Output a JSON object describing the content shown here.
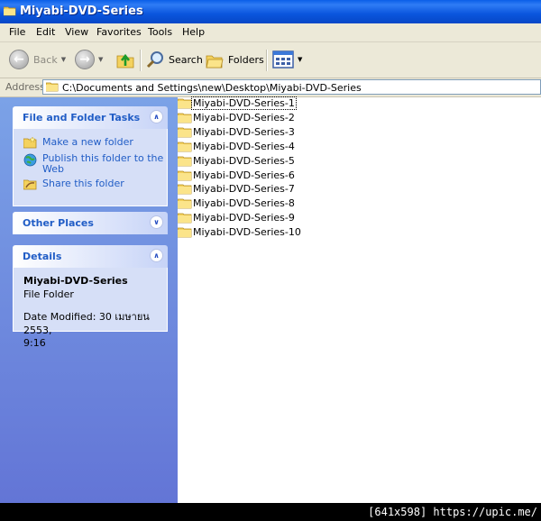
{
  "window": {
    "title": "Miyabi-DVD-Series"
  },
  "menu": {
    "items": [
      "File",
      "Edit",
      "View",
      "Favorites",
      "Tools",
      "Help"
    ]
  },
  "toolbar": {
    "back_label": "Back",
    "search_label": "Search",
    "folders_label": "Folders",
    "icons": {
      "back": "back-arrow-icon",
      "forward": "forward-arrow-icon",
      "up": "folder-up-icon",
      "search": "search-magnifier-icon",
      "folders": "folders-icon",
      "views": "views-icon"
    }
  },
  "address": {
    "label": "Address",
    "path": "C:\\Documents and Settings\\new\\Desktop\\Miyabi-DVD-Series"
  },
  "tasks_panel": {
    "title": "File and Folder Tasks",
    "items": [
      {
        "label": "Make a new folder",
        "icon": "new-folder-icon"
      },
      {
        "label": "Publish this folder to the Web",
        "icon": "globe-icon"
      },
      {
        "label": "Share this folder",
        "icon": "share-folder-icon"
      }
    ]
  },
  "other_places": {
    "title": "Other Places"
  },
  "details": {
    "title": "Details",
    "name": "Miyabi-DVD-Series",
    "type": "File Folder",
    "modified_line1": "Date Modified: 30 เมษายน 2553,",
    "modified_line2": "9:16"
  },
  "files": [
    "Miyabi-DVD-Series-1",
    "Miyabi-DVD-Series-2",
    "Miyabi-DVD-Series-3",
    "Miyabi-DVD-Series-4",
    "Miyabi-DVD-Series-5",
    "Miyabi-DVD-Series-6",
    "Miyabi-DVD-Series-7",
    "Miyabi-DVD-Series-8",
    "Miyabi-DVD-Series-9",
    "Miyabi-DVD-Series-10"
  ],
  "footer": {
    "text": "[641x598] https://upic.me/"
  },
  "colors": {
    "titlebar": "#0a55dd",
    "toolbar_bg": "#ece9d8",
    "task_link": "#215dc6",
    "left_pane_top": "#7ba2e7",
    "left_pane_bottom": "#6375d6"
  }
}
